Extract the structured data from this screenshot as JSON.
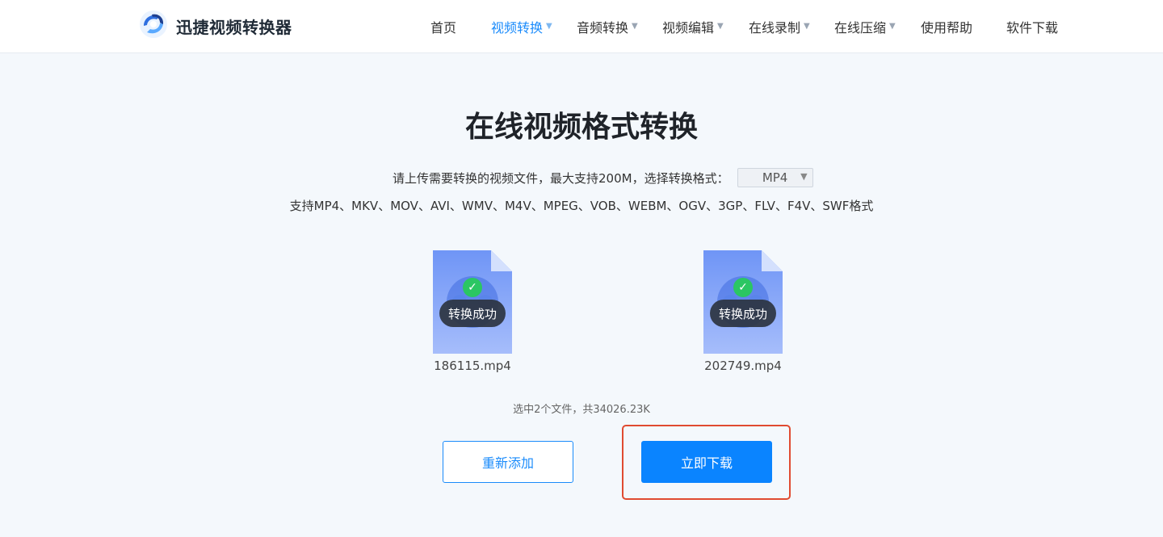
{
  "header": {
    "logo_text": "迅捷视频转换器",
    "nav": [
      {
        "label": "首页",
        "dropdown": false,
        "active": false
      },
      {
        "label": "视频转换",
        "dropdown": true,
        "active": true
      },
      {
        "label": "音频转换",
        "dropdown": true,
        "active": false
      },
      {
        "label": "视频编辑",
        "dropdown": true,
        "active": false
      },
      {
        "label": "在线录制",
        "dropdown": true,
        "active": false
      },
      {
        "label": "在线压缩",
        "dropdown": true,
        "active": false
      },
      {
        "label": "使用帮助",
        "dropdown": false,
        "active": false
      },
      {
        "label": "软件下载",
        "dropdown": false,
        "active": false
      }
    ]
  },
  "main": {
    "title": "在线视频格式转换",
    "upload_hint": "请上传需要转换的视频文件，最大支持200M，选择转换格式：",
    "format_select": {
      "value": "MP4",
      "caret": "▼"
    },
    "supported_formats": "支持MP4、MKV、MOV、AVI、WMV、M4V、MPEG、VOB、WEBM、OGV、3GP、FLV、F4V、SWF格式",
    "files": [
      {
        "name": "186115.mp4",
        "status": "转换成功"
      },
      {
        "name": "202749.mp4",
        "status": "转换成功"
      }
    ],
    "summary": "选中2个文件，共34026.23K",
    "re_add_label": "重新添加",
    "download_label": "立即下载"
  },
  "colors": {
    "accent": "#1a8bfb",
    "primary_button": "#0a84ff",
    "success": "#2bc663",
    "highlight_border": "#e04b31"
  },
  "icons": {
    "logo": "swirl-logo-icon",
    "dropdown": "caret-down-icon",
    "file": "video-file-icon",
    "success": "check-circle-icon"
  }
}
